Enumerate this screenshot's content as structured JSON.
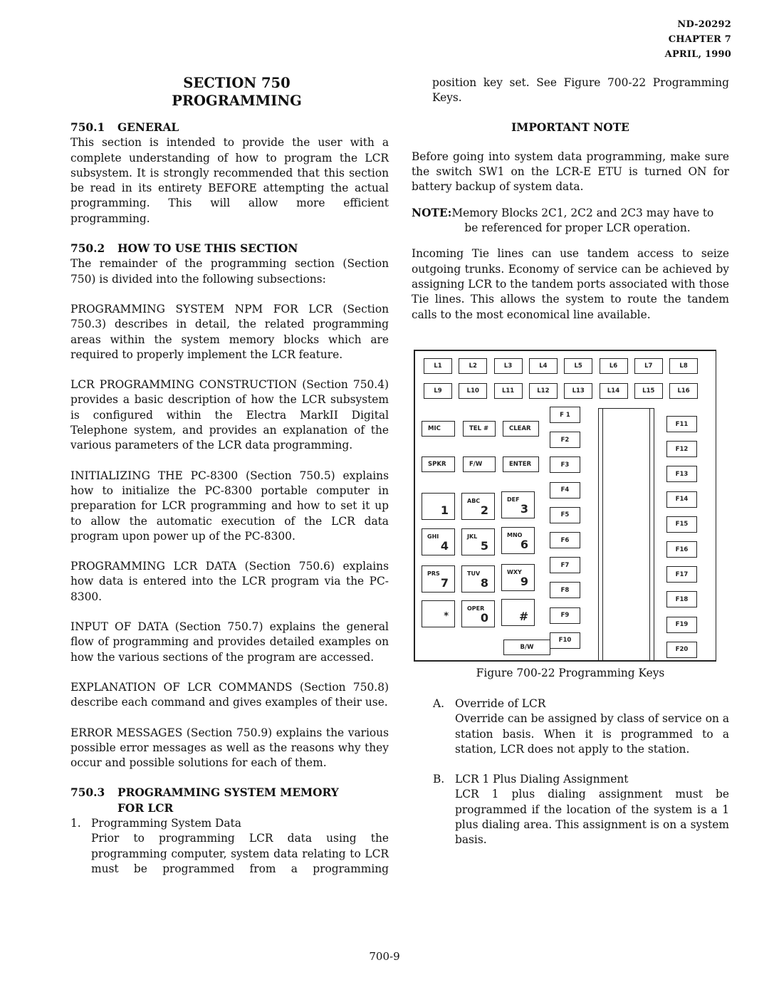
{
  "header": {
    "doc_number": "ND-20292",
    "chapter": "CHAPTER 7",
    "date": "APRIL, 1990"
  },
  "left_column": {
    "section_title": "SECTION 750",
    "section_subtitle": "PROGRAMMING",
    "s750_1": {
      "number": "750.1",
      "heading": "GENERAL",
      "body": "This section is intended to provide the user with a complete understanding of how to program the LCR subsystem.  It is strongly recommended that this section be read in its entirety BEFORE attempting the actual programming.  This will allow more efficient programming."
    },
    "s750_2": {
      "number": "750.2",
      "heading": "HOW TO USE THIS SECTION",
      "intro": "The remainder of the programming section (Section 750) is divided into the following subsections:",
      "paragraphs": [
        "PROGRAMMING SYSTEM NPM FOR LCR (Section 750.3) describes in detail, the related programming areas within the system memory blocks which are required to properly implement the LCR feature.",
        "LCR PROGRAMMING CONSTRUCTION (Section 750.4) provides a basic description of how the LCR subsystem is configured within the Electra MarkII Digital Telephone system, and provides an explanation of the various parameters of the LCR data programming.",
        "INITIALIZING THE PC-8300 (Section 750.5) explains how to initialize the PC-8300 portable computer in preparation for LCR programming and how to set it up to allow the automatic execution of the LCR data program upon power up of the PC-8300.",
        "PROGRAMMING LCR DATA (Section 750.6) explains how data is entered into the LCR program via the PC-8300.",
        "INPUT OF DATA (Section 750.7) explains the general flow of programming and provides detailed examples on how the various sections of the program are accessed.",
        "EXPLANATION OF LCR COMMANDS (Section 750.8) describe each command and gives examples of their use.",
        "ERROR MESSAGES (Section 750.9) explains the various possible error messages as well as the reasons why they occur and possible solutions for each of them."
      ]
    },
    "s750_3": {
      "number": "750.3",
      "heading_line1": "PROGRAMMING SYSTEM MEMORY",
      "heading_line2": "FOR LCR",
      "item_number": "1.",
      "item_title": "Programming System Data",
      "item_body": "Prior to programming LCR data using the programming computer, system data relating to LCR must be programmed from a programming"
    }
  },
  "right_column": {
    "continuation": "position key set.  See Figure 700-22   Programming Keys.",
    "important_note_heading": "IMPORTANT NOTE",
    "important_note_body": "Before going into system data programming, make sure the switch SW1 on the LCR-E ETU is turned ON for battery backup of system data.",
    "note_label": "NOTE:",
    "note_line1": "Memory Blocks 2C1, 2C2 and 2C3 may have to",
    "note_line2": "be referenced for proper LCR operation.",
    "tandem_paragraph": "Incoming Tie lines can use tandem access to seize outgoing trunks.  Economy of service can be achieved by assigning LCR to the tandem ports associated with those Tie lines.  This allows the system to route the tandem calls to the most economical line available."
  },
  "figure": {
    "caption": "Figure 700-22  Programming Keys",
    "line_keys_row1": [
      "L1",
      "L2",
      "L3",
      "L4",
      "L5",
      "L6",
      "L7",
      "L8"
    ],
    "line_keys_row2": [
      "L9",
      "L10",
      "L11",
      "L12",
      "L13",
      "L14",
      "L15",
      "L16"
    ],
    "function_row1": [
      "MIC",
      "TEL #",
      "CLEAR"
    ],
    "function_row2": [
      "SPKR",
      "F/W",
      "ENTER"
    ],
    "dialpad": [
      {
        "letters": "",
        "digit": "1"
      },
      {
        "letters": "ABC",
        "digit": "2"
      },
      {
        "letters": "DEF",
        "digit": "3"
      },
      {
        "letters": "GHI",
        "digit": "4"
      },
      {
        "letters": "JKL",
        "digit": "5"
      },
      {
        "letters": "MNO",
        "digit": "6"
      },
      {
        "letters": "PRS",
        "digit": "7"
      },
      {
        "letters": "TUV",
        "digit": "8"
      },
      {
        "letters": "WXY",
        "digit": "9"
      },
      {
        "letters": "",
        "digit": "*"
      },
      {
        "letters": "OPER",
        "digit": "0"
      },
      {
        "letters": "",
        "digit": "#"
      }
    ],
    "bw_key": "B/W",
    "f_keys_left": [
      "F 1",
      "F2",
      "F3",
      "F4",
      "F5",
      "F6",
      "F7",
      "F8",
      "F9",
      "F10"
    ],
    "f_keys_right": [
      "F11",
      "F12",
      "F13",
      "F14",
      "F15",
      "F16",
      "F17",
      "F18",
      "F19",
      "F20"
    ]
  },
  "list": {
    "a_mark": "A.",
    "a_title": "Override of LCR",
    "a_body": "Override can be assigned by class of service on a station basis.  When it is programmed to a station, LCR does not apply to the station.",
    "b_mark": "B.",
    "b_title": "LCR 1 Plus Dialing Assignment",
    "b_body": "LCR 1 plus dialing assignment must be programmed if the location of the system is a 1 plus dialing area.  This assignment is on a system basis."
  },
  "footer": {
    "page_number": "700-9"
  }
}
